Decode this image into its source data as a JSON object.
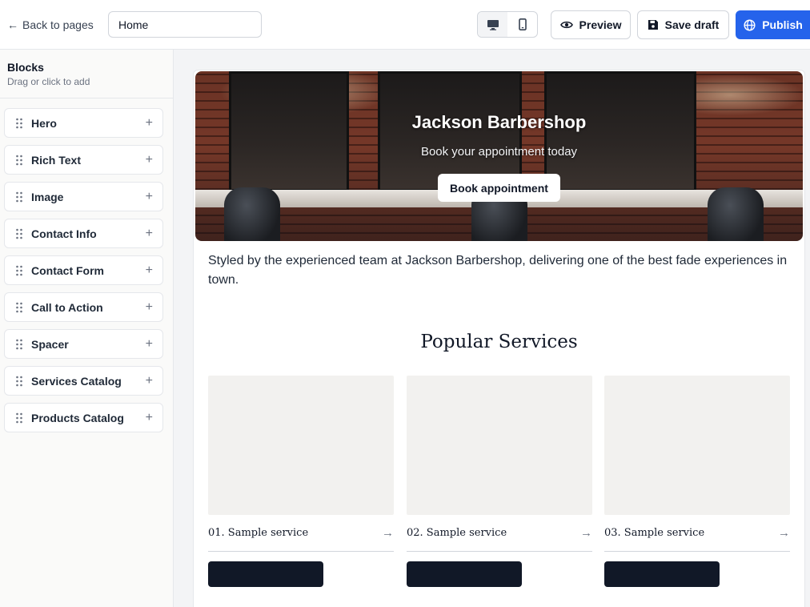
{
  "topbar": {
    "back_label": "Back to pages",
    "page_name_value": "Home",
    "devices": [
      {
        "name": "desktop",
        "icon": "desktop-icon",
        "active": true
      },
      {
        "name": "mobile",
        "icon": "mobile-icon",
        "active": false
      }
    ],
    "preview_label": "Preview",
    "save_label": "Save draft",
    "publish_label": "Publish"
  },
  "sidebar": {
    "title": "Blocks",
    "subtitle": "Drag or click to add",
    "items": [
      {
        "label": "Hero"
      },
      {
        "label": "Rich Text"
      },
      {
        "label": "Image"
      },
      {
        "label": "Contact Info"
      },
      {
        "label": "Contact Form"
      },
      {
        "label": "Call to Action"
      },
      {
        "label": "Spacer"
      },
      {
        "label": "Services Catalog"
      },
      {
        "label": "Products Catalog"
      }
    ]
  },
  "canvas": {
    "hero": {
      "title": "Jackson Barbershop",
      "subtitle": "Book your appointment today",
      "cta_label": "Book appointment"
    },
    "rich_text": "Styled by the experienced team at Jackson Barbershop, delivering one of the best fade experiences in town.",
    "services": {
      "heading": "Popular Services",
      "items": [
        {
          "name": "01. Sample service"
        },
        {
          "name": "02. Sample service"
        },
        {
          "name": "03. Sample service"
        }
      ]
    }
  },
  "colors": {
    "accent": "#2563eb",
    "dark_button": "#111827",
    "placeholder_image": "#f2f1ef"
  }
}
